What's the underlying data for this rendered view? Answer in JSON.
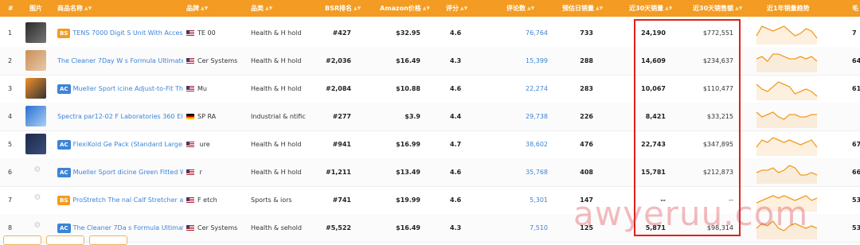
{
  "headers": {
    "idx": "#",
    "img": "图片",
    "name": "商品名称",
    "brand": "品牌",
    "category": "品类",
    "bsr": "BSR排名",
    "price": "Amazon价格",
    "rating": "评分",
    "reviews": "评论数",
    "daily": "预估日销量",
    "sales30": "近30天销量",
    "rev30": "近30天销售额",
    "trend": "近1年销量趋势",
    "extra": "毛"
  },
  "rows": [
    {
      "idx": "1",
      "badge": "BS",
      "title": "TENS 7000 Digit  S Unit With Access",
      "country": "us",
      "brand": "TE  00",
      "category": "Health & H  hold",
      "bsr": "#427",
      "price": "$32.95",
      "rating": "4.6",
      "reviews": "76,764",
      "daily": "733",
      "sales30": "24,190",
      "rev30": "$772,551",
      "extra": "7"
    },
    {
      "idx": "2",
      "badge": "",
      "title": "The Cleaner 7Day W  s Formula Ultimate Bo",
      "country": "us",
      "brand": "Cer  Systems",
      "category": "Health & H  hold",
      "bsr": "#2,036",
      "price": "$16.49",
      "rating": "4.3",
      "reviews": "15,399",
      "daily": "288",
      "sales30": "14,609",
      "rev30": "$234,637",
      "extra": "64"
    },
    {
      "idx": "3",
      "badge": "AC",
      "title": "Mueller Sport  icine Adjust-to-Fit Thum",
      "country": "us",
      "brand": "Mu",
      "category": "Health & H  hold",
      "bsr": "#2,084",
      "price": "$10.88",
      "rating": "4.6",
      "reviews": "22,274",
      "daily": "283",
      "sales30": "10,067",
      "rev30": "$110,477",
      "extra": "61"
    },
    {
      "idx": "4",
      "badge": "",
      "title": "Spectra par12-02 F  Laboratories 360 Electr",
      "country": "de",
      "brand": "SP  RA",
      "category": "Industrial &  ntific",
      "bsr": "#277",
      "price": "$3.9",
      "rating": "4.4",
      "reviews": "29,738",
      "daily": "226",
      "sales30": "8,421",
      "rev30": "$33,215",
      "extra": ""
    },
    {
      "idx": "5",
      "badge": "AC",
      "title": "FlexiKold Ge  Pack (Standard Large: 1(",
      "country": "us",
      "brand": "  ure",
      "category": "Health & H  hold",
      "bsr": "#941",
      "price": "$16.99",
      "rating": "4.7",
      "reviews": "38,602",
      "daily": "476",
      "sales30": "22,743",
      "rev30": "$347,895",
      "extra": "67"
    },
    {
      "idx": "6",
      "badge": "AC",
      "title": "Mueller Sport  dicine Green Fitted Wrist",
      "country": "us",
      "brand": "  r",
      "category": "Health & H  hold",
      "bsr": "#1,211",
      "price": "$13.49",
      "rating": "4.6",
      "reviews": "35,768",
      "daily": "408",
      "sales30": "15,781",
      "rev30": "$212,873",
      "extra": "66"
    },
    {
      "idx": "7",
      "badge": "BS",
      "title": "ProStretch The  nal Calf Stretcher and",
      "country": "us",
      "brand": "F  etch",
      "category": "Sports &  iors",
      "bsr": "#741",
      "price": "$19.99",
      "rating": "4.6",
      "reviews": "5,301",
      "daily": "147",
      "sales30": "--",
      "rev30": "--",
      "extra": "53"
    },
    {
      "idx": "8",
      "badge": "AC",
      "title": "The Cleaner 7Da  s Formula Ultimate",
      "country": "us",
      "brand": "Cer  Systems",
      "category": "Health &  sehold",
      "bsr": "#5,522",
      "price": "$16.49",
      "rating": "4.3",
      "reviews": "7,510",
      "daily": "125",
      "sales30": "5,871",
      "rev30": "$98,314",
      "extra": "53"
    }
  ],
  "trend_series": [
    [
      3,
      7,
      6,
      5,
      6,
      7,
      5,
      3,
      4,
      6,
      5,
      2
    ],
    [
      5,
      6,
      4,
      7,
      7,
      6,
      5,
      5,
      6,
      5,
      6,
      4
    ],
    [
      6,
      4,
      3,
      5,
      7,
      6,
      5,
      2,
      3,
      4,
      3,
      1
    ],
    [
      6,
      4,
      5,
      6,
      4,
      3,
      5,
      5,
      4,
      4,
      5,
      5
    ],
    [
      3,
      6,
      5,
      7,
      6,
      5,
      6,
      5,
      4,
      5,
      6,
      3
    ],
    [
      4,
      5,
      5,
      6,
      4,
      5,
      7,
      6,
      3,
      3,
      4,
      3
    ],
    [
      3,
      4,
      5,
      6,
      5,
      6,
      5,
      4,
      5,
      6,
      4,
      5
    ],
    [
      4,
      6,
      5,
      7,
      4,
      3,
      5,
      6,
      5,
      4,
      5,
      4
    ]
  ],
  "watermark": "awyeruu.com",
  "colors": {
    "accent": "#f39b22",
    "link": "#3d84d6",
    "highlight": "#e0201c"
  }
}
